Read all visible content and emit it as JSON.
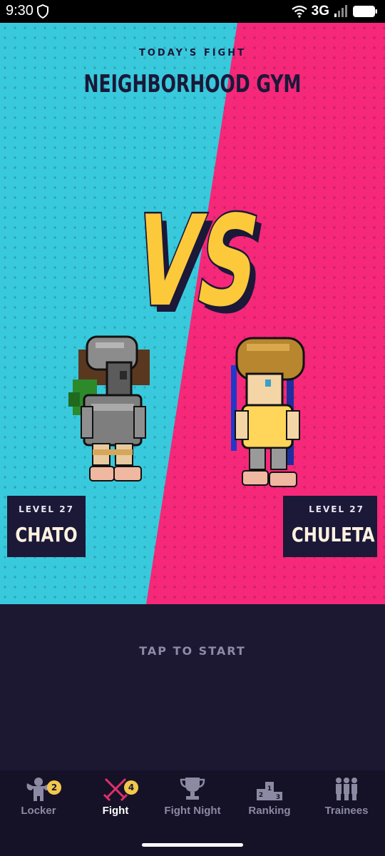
{
  "status": {
    "time": "9:30",
    "network": "3G"
  },
  "fight": {
    "kicker": "TODAY'S FIGHT",
    "title": "NEIGHBORHOOD GYM",
    "vs": "VS",
    "left_fighter": {
      "level": "LEVEL 27",
      "name": "CHATO"
    },
    "right_fighter": {
      "level": "LEVEL 27",
      "name": "CHULETA"
    },
    "cta": "TAP TO START"
  },
  "tabs": [
    {
      "label": "Locker",
      "icon": "muscle-icon",
      "badge": "2",
      "active": false
    },
    {
      "label": "Fight",
      "icon": "crossed-swords-icon",
      "badge": "4",
      "active": true
    },
    {
      "label": "Fight Night",
      "icon": "trophy-icon",
      "badge": "",
      "active": false
    },
    {
      "label": "Ranking",
      "icon": "podium-icon",
      "badge": "",
      "active": false
    },
    {
      "label": "Trainees",
      "icon": "group-icon",
      "badge": "",
      "active": false
    }
  ],
  "colors": {
    "left_bg": "#39c9dc",
    "right_bg": "#f5287a",
    "dark": "#1b1838",
    "vs_fill": "#fcc93a",
    "badge": "#f2c84b"
  }
}
